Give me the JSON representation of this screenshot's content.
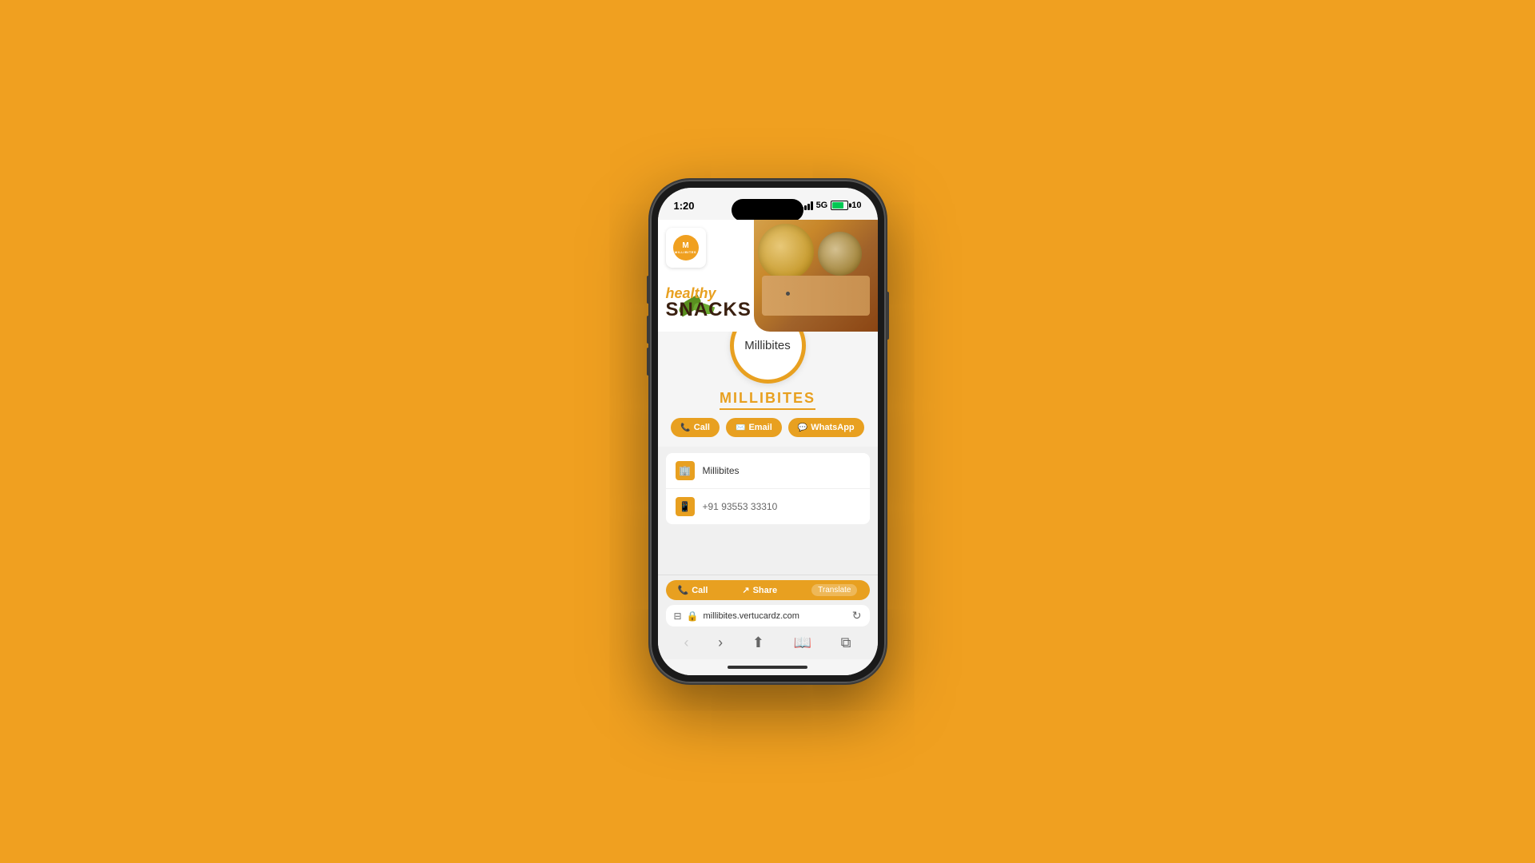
{
  "background": {
    "color": "#F0A020"
  },
  "phone": {
    "status_bar": {
      "time": "1:20",
      "signal_label": "5G",
      "battery_label": "10"
    },
    "app": {
      "hero": {
        "brand_name": "MILLIBITES",
        "healthy_text": "healthy",
        "snacks_text": "SNACKS"
      },
      "profile": {
        "name": "MILLIBITES",
        "avatar_text": "Millibites"
      },
      "buttons": {
        "call": "Call",
        "email": "Email",
        "whatsapp": "WhatsApp"
      },
      "info": {
        "company": "Millibites",
        "phone_partial": "+91 93553 33310"
      },
      "action_bar": {
        "call": "Call",
        "share": "Share",
        "translate": "Translate"
      },
      "url_bar": {
        "url": "millibites.vertucardz.com"
      }
    }
  }
}
